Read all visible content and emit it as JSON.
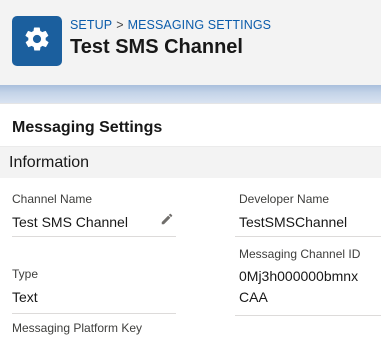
{
  "header": {
    "icon": "gear-icon",
    "breadcrumb": {
      "root": "SETUP",
      "separator": ">",
      "current": "MESSAGING SETTINGS"
    },
    "title": "Test SMS Channel"
  },
  "card": {
    "title": "Messaging Settings",
    "section": "Information",
    "fields": {
      "channel_name": {
        "label": "Channel Name",
        "value": "Test SMS Channel"
      },
      "developer_name": {
        "label": "Developer Name",
        "value": "TestSMSChannel"
      },
      "messaging_channel_id": {
        "label": "Messaging Channel ID",
        "value_line1": "0Mj3h000000bmnx",
        "value_line2": "CAA"
      },
      "type": {
        "label": "Type",
        "value": "Text"
      },
      "messaging_platform_key": {
        "label": "Messaging Platform Key"
      }
    }
  },
  "colors": {
    "brand_icon_bg": "#1b5f9e",
    "link": "#0b5cab",
    "header_bg": "#f3f3f3",
    "section_bg": "#f3f3f3"
  }
}
